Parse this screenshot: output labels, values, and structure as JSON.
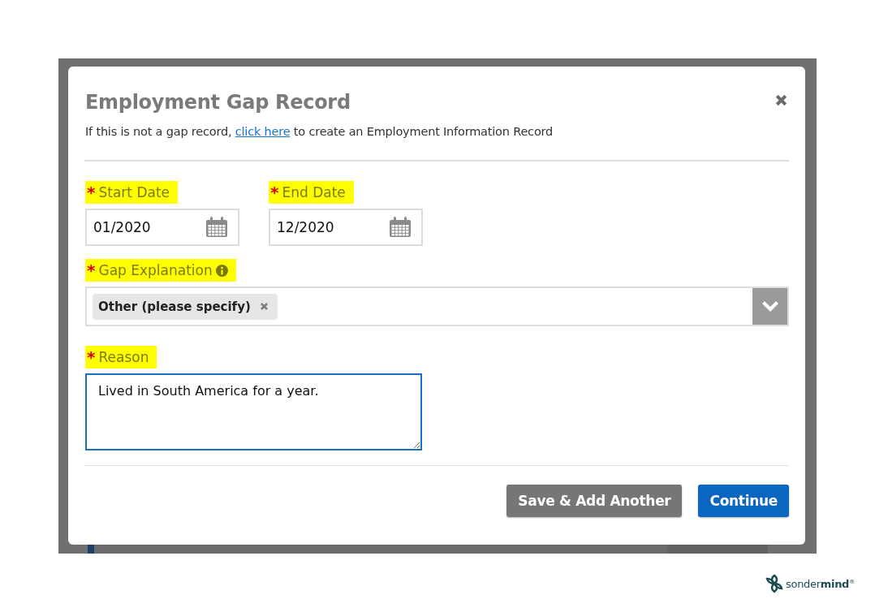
{
  "dialog": {
    "title": "Employment Gap Record",
    "note_before": "If this is not a gap record, ",
    "note_link": "click here",
    "note_after": " to create an Employment Information Record",
    "date_fields": [
      {
        "label": "Start Date",
        "required": "*",
        "highlighted": true,
        "value": "01/2020"
      },
      {
        "label": "End Date",
        "required": "*",
        "highlighted": true,
        "value": "12/2020"
      }
    ],
    "gap_explanation": {
      "label": "Gap Explanation",
      "required": "*",
      "highlighted": true,
      "info": true,
      "chips": [
        "Other (please specify)"
      ]
    },
    "reason": {
      "label": "Reason",
      "required": "*",
      "highlighted": true,
      "value": "Lived in South America for a year.",
      "focused": true
    },
    "buttons": [
      {
        "label": "Save & Add Another",
        "kind": "secondary"
      },
      {
        "label": "Continue",
        "kind": "primary"
      }
    ]
  },
  "brand": {
    "name_light": "sonder",
    "name_bold": "mind",
    "mark": "®"
  }
}
